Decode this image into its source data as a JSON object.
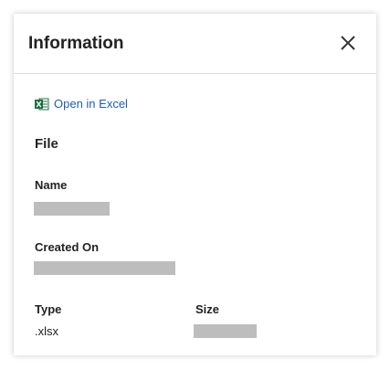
{
  "panel": {
    "title": "Information",
    "close_icon": "close-icon"
  },
  "actions": {
    "open_excel_label": "Open in Excel",
    "open_excel_icon": "excel-icon"
  },
  "file_section": {
    "heading": "File",
    "name_label": "Name",
    "created_on_label": "Created On",
    "type_label": "Type",
    "type_value": ".xlsx",
    "size_label": "Size"
  },
  "colors": {
    "link": "#1f5bb8",
    "excel_green": "#1d6f42",
    "redaction": "#bdbdbd"
  }
}
